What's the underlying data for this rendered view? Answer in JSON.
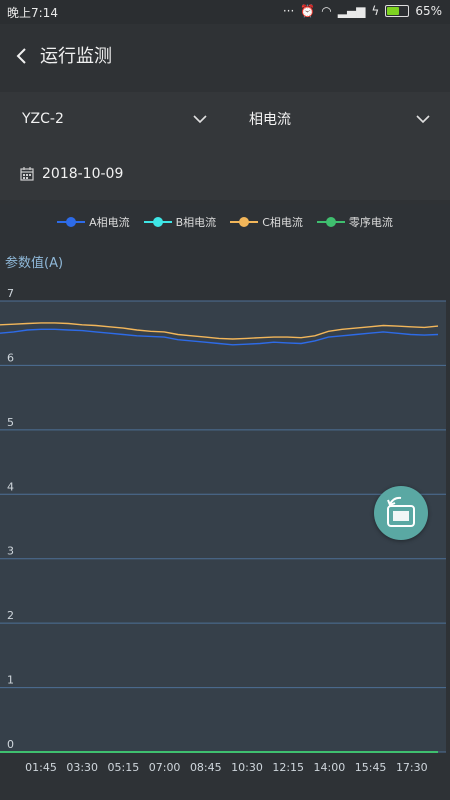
{
  "status_bar": {
    "time": "晚上7:14",
    "battery_pct": "65%",
    "battery_level": 0.65
  },
  "header": {
    "title": "运行监测"
  },
  "selectors": {
    "device": "YZC-2",
    "type": "相电流",
    "date": "2018-10-09"
  },
  "colors": {
    "a": "#2d6be8",
    "b": "#3ee6e6",
    "c": "#f2b65a",
    "zero": "#3fbf6f"
  },
  "chart_data": {
    "type": "line",
    "ylabel": "参数值(A)",
    "ylim": [
      0,
      7
    ],
    "yticks": [
      "0",
      "1",
      "2",
      "3",
      "4",
      "5",
      "6",
      "7"
    ],
    "xticks": [
      "01:45",
      "03:30",
      "05:15",
      "07:00",
      "08:45",
      "10:30",
      "12:15",
      "14:00",
      "15:45",
      "17:30"
    ],
    "x": [
      "01:45",
      "02:15",
      "02:45",
      "03:15",
      "03:45",
      "04:15",
      "04:45",
      "05:15",
      "05:45",
      "06:15",
      "06:45",
      "07:15",
      "07:45",
      "08:15",
      "08:45",
      "09:15",
      "09:45",
      "10:15",
      "10:45",
      "11:15",
      "11:45",
      "12:15",
      "12:45",
      "13:15",
      "13:45",
      "14:15",
      "14:45",
      "15:15",
      "15:45",
      "16:15",
      "16:45",
      "17:15",
      "17:45"
    ],
    "series": [
      {
        "name": "A相电流",
        "color": "#2d6be8",
        "values": [
          6.5,
          6.52,
          6.55,
          6.56,
          6.56,
          6.55,
          6.54,
          6.52,
          6.5,
          6.48,
          6.46,
          6.45,
          6.44,
          6.4,
          6.38,
          6.36,
          6.34,
          6.32,
          6.33,
          6.34,
          6.36,
          6.35,
          6.34,
          6.38,
          6.44,
          6.46,
          6.48,
          6.5,
          6.52,
          6.5,
          6.48,
          6.47,
          6.48
        ]
      },
      {
        "name": "B相电流",
        "color": "#3ee6e6",
        "values": []
      },
      {
        "name": "C相电流",
        "color": "#f2b65a",
        "values": [
          6.63,
          6.64,
          6.65,
          6.66,
          6.66,
          6.65,
          6.63,
          6.62,
          6.6,
          6.58,
          6.55,
          6.53,
          6.52,
          6.48,
          6.46,
          6.44,
          6.42,
          6.41,
          6.42,
          6.43,
          6.44,
          6.44,
          6.43,
          6.46,
          6.53,
          6.56,
          6.58,
          6.6,
          6.62,
          6.61,
          6.6,
          6.59,
          6.61
        ]
      },
      {
        "name": "零序电流",
        "color": "#3fbf6f",
        "values": [
          0,
          0,
          0,
          0,
          0,
          0,
          0,
          0,
          0,
          0,
          0,
          0,
          0,
          0,
          0,
          0,
          0,
          0,
          0,
          0,
          0,
          0,
          0,
          0,
          0,
          0,
          0,
          0,
          0,
          0,
          0,
          0,
          0
        ]
      }
    ]
  }
}
